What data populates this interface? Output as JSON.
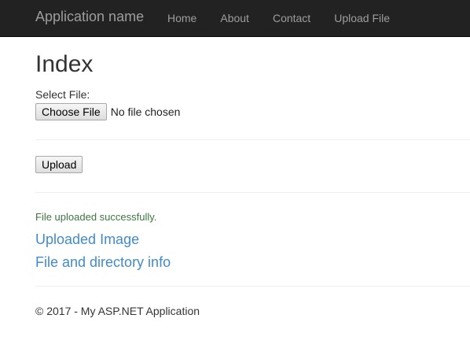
{
  "navbar": {
    "brand": "Application name",
    "links": [
      "Home",
      "About",
      "Contact",
      "Upload File"
    ]
  },
  "main": {
    "title": "Index",
    "file_label": "Select File:",
    "choose_button": "Choose File",
    "file_status": "No file chosen",
    "upload_button": "Upload",
    "success_message": "File uploaded successfully.",
    "links": [
      "Uploaded Image",
      "File and directory info"
    ]
  },
  "footer": {
    "text": "© 2017 - My ASP.NET Application"
  },
  "colors": {
    "navbar_bg": "#222222",
    "nav_text": "#9d9d9d",
    "link": "#428bca",
    "success": "#3c763d"
  }
}
